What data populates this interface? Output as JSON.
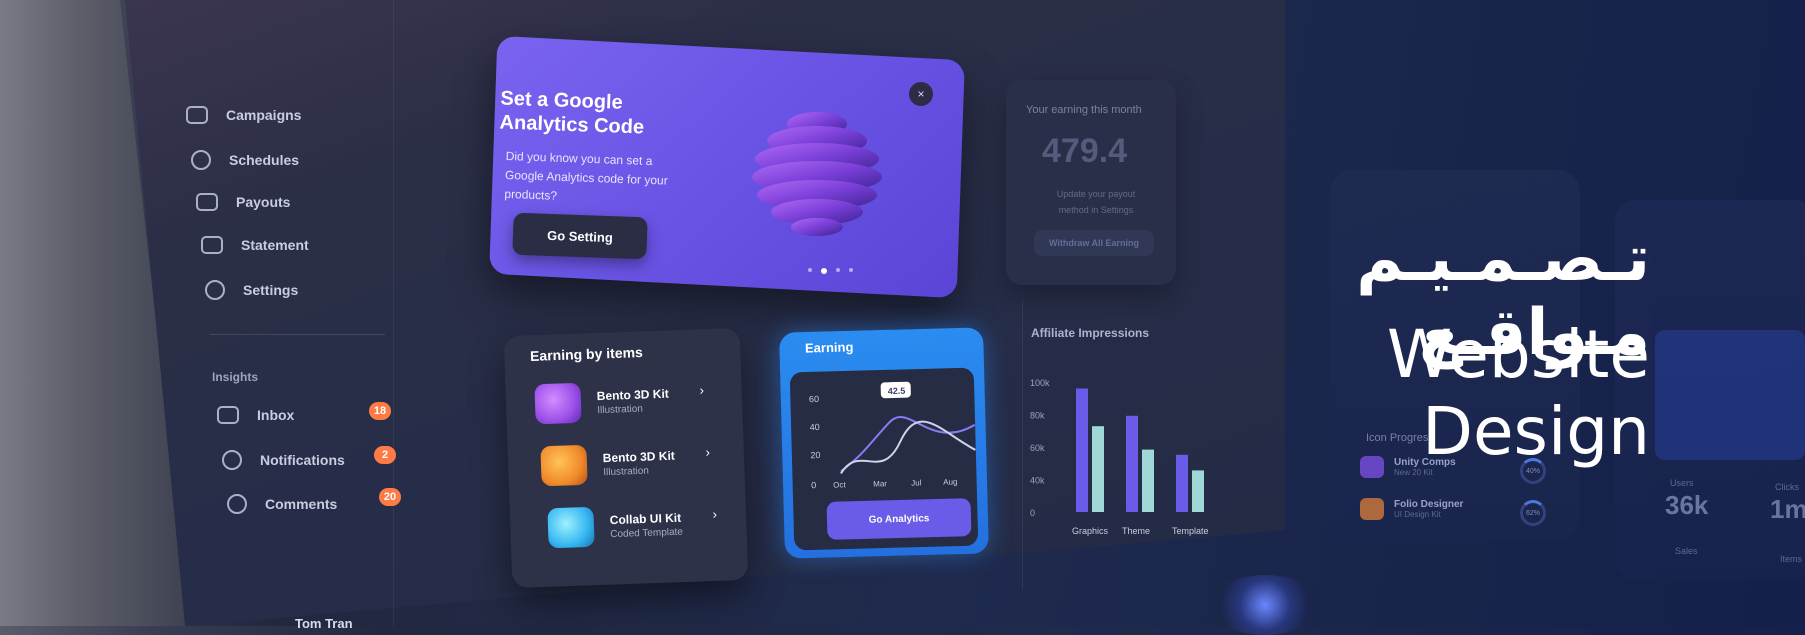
{
  "sidebar": {
    "items": [
      {
        "label": "Campaigns",
        "icon": "bar-chart-icon"
      },
      {
        "label": "Schedules",
        "icon": "compass-icon"
      },
      {
        "label": "Payouts",
        "icon": "wallet-icon"
      },
      {
        "label": "Statement",
        "icon": "document-icon"
      },
      {
        "label": "Settings",
        "icon": "gear-icon"
      }
    ],
    "section_label": "Insights",
    "insights": [
      {
        "label": "Inbox",
        "badge": "18",
        "icon": "mail-icon"
      },
      {
        "label": "Notifications",
        "badge": "2",
        "icon": "bell-icon"
      },
      {
        "label": "Comments",
        "badge": "20",
        "icon": "chat-icon"
      }
    ],
    "user_name": "Tom Tran"
  },
  "promo": {
    "title": "Set a Google Analytics Code",
    "text": "Did you know you can set a Google Analytics code for your products?",
    "button": "Go Setting",
    "close": "×"
  },
  "earning_month": {
    "label": "Your earning this month",
    "value": "479.4",
    "note": "Update your payout method in Settings",
    "button": "Withdraw All Earning"
  },
  "earning_items": {
    "title": "Earning by items",
    "items": [
      {
        "name": "Bento 3D Kit",
        "sub": "Illustration",
        "color": "#9a4fe8"
      },
      {
        "name": "Bento 3D Kit",
        "sub": "Illustration",
        "color": "#f08a2a"
      },
      {
        "name": "Collab UI Kit",
        "sub": "Coded Template",
        "color": "#35b6f0"
      }
    ]
  },
  "earning_chart": {
    "title": "Earning",
    "tooltip": "42.5",
    "button": "Go Analytics",
    "y_ticks": [
      "60",
      "40",
      "20",
      "0"
    ],
    "x_ticks": [
      "Oct",
      "Mar",
      "Jul",
      "Aug"
    ]
  },
  "affiliate": {
    "title": "Affiliate Impressions"
  },
  "chart_data": {
    "type": "bar",
    "categories": [
      "Graphics",
      "Theme",
      "Template"
    ],
    "series": [
      {
        "values": [
          95,
          74,
          44
        ]
      },
      {
        "values": [
          66,
          48,
          32
        ]
      }
    ],
    "y_ticks": [
      "100k",
      "80k",
      "60k",
      "40k",
      "0"
    ],
    "ylim": [
      0,
      100
    ],
    "colors": [
      "#6a5ce8",
      "#9fd8d6"
    ]
  },
  "devices": {
    "icon_progress_label": "Icon Progress",
    "progress": [
      {
        "name": "Unity Comps",
        "sub": "New 20 Kit",
        "pct": "40%"
      },
      {
        "name": "Folio Designer",
        "sub": "UI Design Kit",
        "pct": "62%"
      }
    ],
    "stats": [
      {
        "label": "Users",
        "value": "36k"
      },
      {
        "label": "Clicks",
        "value": "1m"
      }
    ],
    "footer": [
      "Sales",
      "Items"
    ]
  },
  "headline": {
    "arabic": "تـصـمـيـم مـواقـع",
    "english": "Website Design"
  }
}
